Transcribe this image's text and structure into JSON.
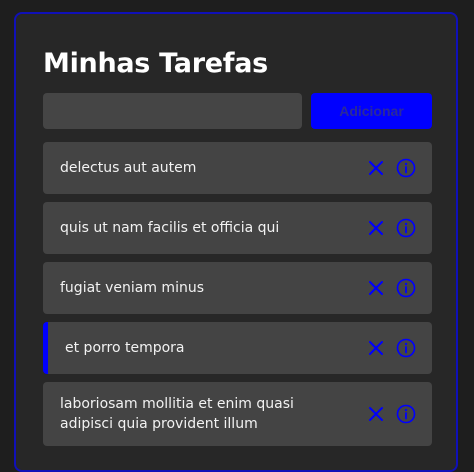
{
  "app": {
    "title": "Minhas Tarefas"
  },
  "form": {
    "input_value": "",
    "input_placeholder": "",
    "add_label": "Adicionar"
  },
  "colors": {
    "accent": "#0000ff",
    "panel_border": "#1010b8",
    "background": "#1e1e1e",
    "panel": "#272727",
    "item": "#444444"
  },
  "tasks": [
    {
      "text": "delectus aut autem",
      "selected": false,
      "icons": [
        "close-icon",
        "info-icon"
      ]
    },
    {
      "text": "quis ut nam facilis et officia qui",
      "selected": false,
      "icons": [
        "close-icon",
        "info-icon"
      ]
    },
    {
      "text": "fugiat veniam minus",
      "selected": false,
      "icons": [
        "close-icon",
        "info-icon"
      ]
    },
    {
      "text": "et porro tempora",
      "selected": true,
      "icons": [
        "close-icon",
        "info-icon"
      ]
    },
    {
      "text": "laboriosam mollitia et enim quasi adipisci quia provident illum",
      "selected": false,
      "icons": [
        "close-icon",
        "info-icon"
      ]
    }
  ]
}
